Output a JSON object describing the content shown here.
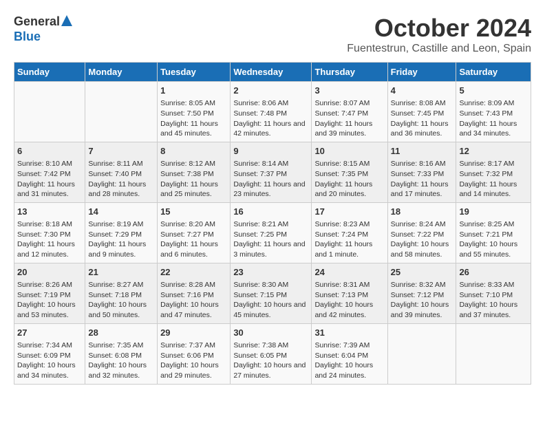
{
  "logo": {
    "general": "General",
    "blue": "Blue"
  },
  "title": "October 2024",
  "location": "Fuentestrun, Castille and Leon, Spain",
  "headers": [
    "Sunday",
    "Monday",
    "Tuesday",
    "Wednesday",
    "Thursday",
    "Friday",
    "Saturday"
  ],
  "weeks": [
    [
      {
        "day": "",
        "content": ""
      },
      {
        "day": "",
        "content": ""
      },
      {
        "day": "1",
        "content": "Sunrise: 8:05 AM\nSunset: 7:50 PM\nDaylight: 11 hours and 45 minutes."
      },
      {
        "day": "2",
        "content": "Sunrise: 8:06 AM\nSunset: 7:48 PM\nDaylight: 11 hours and 42 minutes."
      },
      {
        "day": "3",
        "content": "Sunrise: 8:07 AM\nSunset: 7:47 PM\nDaylight: 11 hours and 39 minutes."
      },
      {
        "day": "4",
        "content": "Sunrise: 8:08 AM\nSunset: 7:45 PM\nDaylight: 11 hours and 36 minutes."
      },
      {
        "day": "5",
        "content": "Sunrise: 8:09 AM\nSunset: 7:43 PM\nDaylight: 11 hours and 34 minutes."
      }
    ],
    [
      {
        "day": "6",
        "content": "Sunrise: 8:10 AM\nSunset: 7:42 PM\nDaylight: 11 hours and 31 minutes."
      },
      {
        "day": "7",
        "content": "Sunrise: 8:11 AM\nSunset: 7:40 PM\nDaylight: 11 hours and 28 minutes."
      },
      {
        "day": "8",
        "content": "Sunrise: 8:12 AM\nSunset: 7:38 PM\nDaylight: 11 hours and 25 minutes."
      },
      {
        "day": "9",
        "content": "Sunrise: 8:14 AM\nSunset: 7:37 PM\nDaylight: 11 hours and 23 minutes."
      },
      {
        "day": "10",
        "content": "Sunrise: 8:15 AM\nSunset: 7:35 PM\nDaylight: 11 hours and 20 minutes."
      },
      {
        "day": "11",
        "content": "Sunrise: 8:16 AM\nSunset: 7:33 PM\nDaylight: 11 hours and 17 minutes."
      },
      {
        "day": "12",
        "content": "Sunrise: 8:17 AM\nSunset: 7:32 PM\nDaylight: 11 hours and 14 minutes."
      }
    ],
    [
      {
        "day": "13",
        "content": "Sunrise: 8:18 AM\nSunset: 7:30 PM\nDaylight: 11 hours and 12 minutes."
      },
      {
        "day": "14",
        "content": "Sunrise: 8:19 AM\nSunset: 7:29 PM\nDaylight: 11 hours and 9 minutes."
      },
      {
        "day": "15",
        "content": "Sunrise: 8:20 AM\nSunset: 7:27 PM\nDaylight: 11 hours and 6 minutes."
      },
      {
        "day": "16",
        "content": "Sunrise: 8:21 AM\nSunset: 7:25 PM\nDaylight: 11 hours and 3 minutes."
      },
      {
        "day": "17",
        "content": "Sunrise: 8:23 AM\nSunset: 7:24 PM\nDaylight: 11 hours and 1 minute."
      },
      {
        "day": "18",
        "content": "Sunrise: 8:24 AM\nSunset: 7:22 PM\nDaylight: 10 hours and 58 minutes."
      },
      {
        "day": "19",
        "content": "Sunrise: 8:25 AM\nSunset: 7:21 PM\nDaylight: 10 hours and 55 minutes."
      }
    ],
    [
      {
        "day": "20",
        "content": "Sunrise: 8:26 AM\nSunset: 7:19 PM\nDaylight: 10 hours and 53 minutes."
      },
      {
        "day": "21",
        "content": "Sunrise: 8:27 AM\nSunset: 7:18 PM\nDaylight: 10 hours and 50 minutes."
      },
      {
        "day": "22",
        "content": "Sunrise: 8:28 AM\nSunset: 7:16 PM\nDaylight: 10 hours and 47 minutes."
      },
      {
        "day": "23",
        "content": "Sunrise: 8:30 AM\nSunset: 7:15 PM\nDaylight: 10 hours and 45 minutes."
      },
      {
        "day": "24",
        "content": "Sunrise: 8:31 AM\nSunset: 7:13 PM\nDaylight: 10 hours and 42 minutes."
      },
      {
        "day": "25",
        "content": "Sunrise: 8:32 AM\nSunset: 7:12 PM\nDaylight: 10 hours and 39 minutes."
      },
      {
        "day": "26",
        "content": "Sunrise: 8:33 AM\nSunset: 7:10 PM\nDaylight: 10 hours and 37 minutes."
      }
    ],
    [
      {
        "day": "27",
        "content": "Sunrise: 7:34 AM\nSunset: 6:09 PM\nDaylight: 10 hours and 34 minutes."
      },
      {
        "day": "28",
        "content": "Sunrise: 7:35 AM\nSunset: 6:08 PM\nDaylight: 10 hours and 32 minutes."
      },
      {
        "day": "29",
        "content": "Sunrise: 7:37 AM\nSunset: 6:06 PM\nDaylight: 10 hours and 29 minutes."
      },
      {
        "day": "30",
        "content": "Sunrise: 7:38 AM\nSunset: 6:05 PM\nDaylight: 10 hours and 27 minutes."
      },
      {
        "day": "31",
        "content": "Sunrise: 7:39 AM\nSunset: 6:04 PM\nDaylight: 10 hours and 24 minutes."
      },
      {
        "day": "",
        "content": ""
      },
      {
        "day": "",
        "content": ""
      }
    ]
  ]
}
